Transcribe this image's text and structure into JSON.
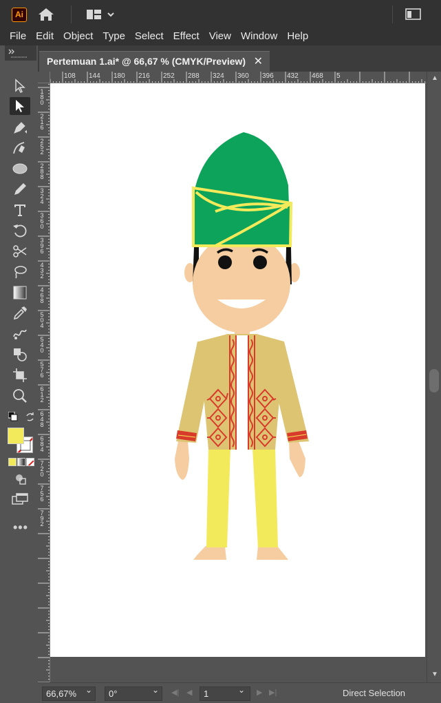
{
  "app": {
    "logo_text": "Ai"
  },
  "menu": [
    "File",
    "Edit",
    "Object",
    "Type",
    "Select",
    "Effect",
    "View",
    "Window",
    "Help"
  ],
  "document_tab": {
    "title": "Pertemuan 1.ai* @ 66,67 % (CMYK/Preview)",
    "close": "✕"
  },
  "ruler_top": [
    "108",
    "144",
    "180",
    "216",
    "252",
    "288",
    "324",
    "360",
    "396",
    "432",
    "468",
    "5"
  ],
  "ruler_left": [
    [
      "1",
      "8",
      "0"
    ],
    [
      "2",
      "1",
      "6"
    ],
    [
      "2",
      "5",
      "2"
    ],
    [
      "2",
      "8",
      "8"
    ],
    [
      "3",
      "2",
      "4"
    ],
    [
      "3",
      "6",
      "0"
    ],
    [
      "3",
      "9",
      "6"
    ],
    [
      "4",
      "3",
      "2"
    ],
    [
      "4",
      "6",
      "8"
    ],
    [
      "5",
      "0",
      "4"
    ],
    [
      "5",
      "4",
      "0"
    ],
    [
      "5",
      "7",
      "6"
    ],
    [
      "6",
      "1",
      "2"
    ],
    [
      "6",
      "4",
      "8"
    ],
    [
      "6",
      "8",
      "4"
    ],
    [
      "7",
      "2",
      "0"
    ],
    [
      "7",
      "5",
      "6"
    ],
    [
      "7",
      "9",
      "2"
    ]
  ],
  "tools": [
    "selection-tool",
    "direct-selection-tool",
    "pen-tool",
    "curvature-tool",
    "ellipse-tool",
    "pencil-tool",
    "type-tool",
    "rotate-tool",
    "scissors-tool",
    "lasso-tool",
    "gradient-tool",
    "eyedropper-tool",
    "blend-tool",
    "shape-builder-tool",
    "crop-tool",
    "zoom-tool"
  ],
  "colors": {
    "fill": "#f3ea5b",
    "stroke": "none",
    "skin": "#f5cda1",
    "hat": "#0da35b",
    "hat_trim": "#f3ea5b",
    "shirt": "#dcc472",
    "pattern": "#d93b2b",
    "pants": "#f3ea5b"
  },
  "more_tools": "•••",
  "statusbar": {
    "zoom": "66,67%",
    "rotation": "0°",
    "artboard": "1",
    "current_tool": "Direct Selection"
  }
}
